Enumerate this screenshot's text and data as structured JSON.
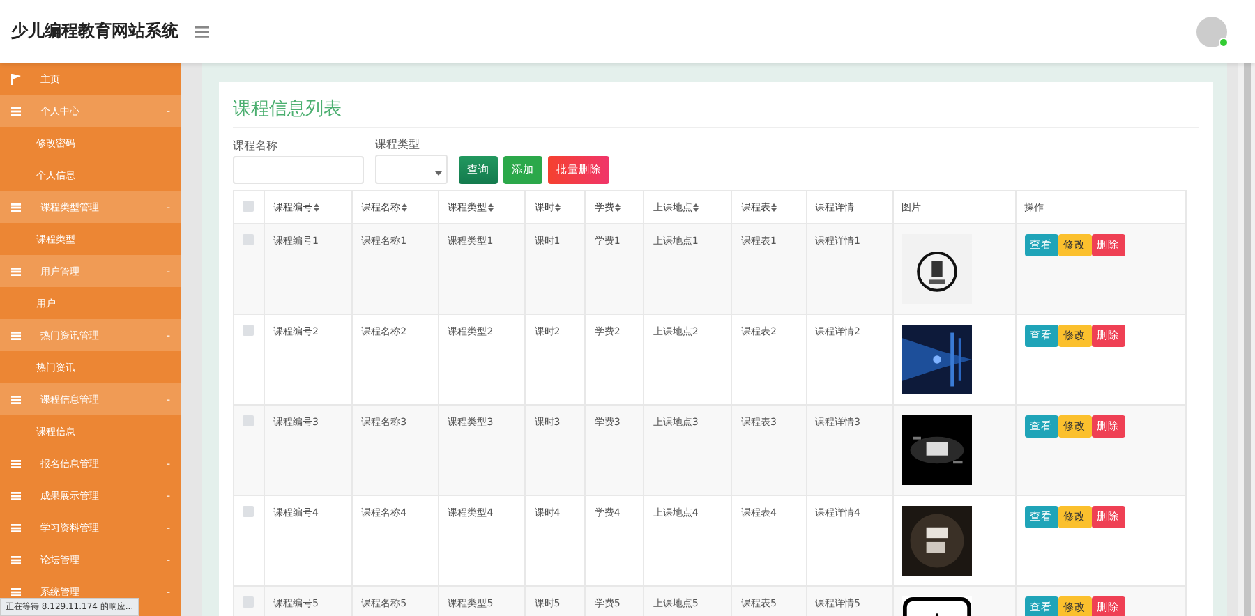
{
  "header": {
    "title": "少儿编程教育网站系统"
  },
  "sidebar": {
    "items": [
      {
        "label": "主页",
        "kind": "home",
        "expanded": false
      },
      {
        "label": "个人中心",
        "kind": "group",
        "expanded": true,
        "children": [
          {
            "label": "修改密码"
          },
          {
            "label": "个人信息"
          }
        ]
      },
      {
        "label": "课程类型管理",
        "kind": "group",
        "expanded": true,
        "children": [
          {
            "label": "课程类型"
          }
        ]
      },
      {
        "label": "用户管理",
        "kind": "group",
        "expanded": true,
        "children": [
          {
            "label": "用户"
          }
        ]
      },
      {
        "label": "热门资讯管理",
        "kind": "group",
        "expanded": true,
        "children": [
          {
            "label": "热门资讯"
          }
        ]
      },
      {
        "label": "课程信息管理",
        "kind": "group",
        "expanded": true,
        "children": [
          {
            "label": "课程信息"
          }
        ]
      },
      {
        "label": "报名信息管理",
        "kind": "group",
        "expanded": false
      },
      {
        "label": "成果展示管理",
        "kind": "group",
        "expanded": false
      },
      {
        "label": "学习资料管理",
        "kind": "group",
        "expanded": false
      },
      {
        "label": "论坛管理",
        "kind": "group",
        "expanded": false
      },
      {
        "label": "系统管理",
        "kind": "group",
        "expanded": false
      }
    ],
    "toggle": "-"
  },
  "page_title": "课程信息列表",
  "search": {
    "fields": [
      {
        "label": "课程名称",
        "kind": "text"
      },
      {
        "label": "课程类型",
        "kind": "select"
      }
    ],
    "buttons": [
      {
        "label": "查询",
        "kind": "query"
      },
      {
        "label": "添加",
        "kind": "add"
      },
      {
        "label": "批量删除",
        "kind": "delete"
      }
    ]
  },
  "table": {
    "select_all": {
      "checked": false
    },
    "columns": [
      {
        "label": "课程编号",
        "sortable": true
      },
      {
        "label": "课程名称",
        "sortable": true
      },
      {
        "label": "课程类型",
        "sortable": true
      },
      {
        "label": "课时",
        "sortable": true
      },
      {
        "label": "学费",
        "sortable": true
      },
      {
        "label": "上课地点",
        "sortable": true
      },
      {
        "label": "课程表",
        "sortable": true
      },
      {
        "label": "课程详情",
        "sortable": false
      },
      {
        "label": "图片",
        "sortable": false
      },
      {
        "label": "操作",
        "sortable": false
      }
    ],
    "rows": [
      {
        "checked": false,
        "cells": [
          "课程编号1",
          "课程名称1",
          "课程类型1",
          "课时1",
          "学费1",
          "上课地点1",
          "课程表1",
          "课程详情1"
        ],
        "actions": [
          {
            "label": "查看",
            "kind": "view"
          },
          {
            "label": "修改",
            "kind": "edit"
          },
          {
            "label": "删除",
            "kind": "delete"
          }
        ]
      },
      {
        "checked": false,
        "cells": [
          "课程编号2",
          "课程名称2",
          "课程类型2",
          "课时2",
          "学费2",
          "上课地点2",
          "课程表2",
          "课程详情2"
        ],
        "actions": [
          {
            "label": "查看",
            "kind": "view"
          },
          {
            "label": "修改",
            "kind": "edit"
          },
          {
            "label": "删除",
            "kind": "delete"
          }
        ]
      },
      {
        "checked": false,
        "cells": [
          "课程编号3",
          "课程名称3",
          "课程类型3",
          "课时3",
          "学费3",
          "上课地点3",
          "课程表3",
          "课程详情3"
        ],
        "actions": [
          {
            "label": "查看",
            "kind": "view"
          },
          {
            "label": "修改",
            "kind": "edit"
          },
          {
            "label": "删除",
            "kind": "delete"
          }
        ]
      },
      {
        "checked": false,
        "cells": [
          "课程编号4",
          "课程名称4",
          "课程类型4",
          "课时4",
          "学费4",
          "上课地点4",
          "课程表4",
          "课程详情4"
        ],
        "actions": [
          {
            "label": "查看",
            "kind": "view"
          },
          {
            "label": "修改",
            "kind": "edit"
          },
          {
            "label": "删除",
            "kind": "delete"
          }
        ]
      },
      {
        "checked": false,
        "cells": [
          "课程编号5",
          "课程名称5",
          "课程类型5",
          "课时5",
          "学费5",
          "上课地点5",
          "课程表5",
          "课程详情5"
        ],
        "actions": [
          {
            "label": "查看",
            "kind": "view"
          },
          {
            "label": "修改",
            "kind": "edit"
          },
          {
            "label": "删除",
            "kind": "delete"
          }
        ]
      }
    ]
  },
  "status_bar": "正在等待 8.129.11.174 的响应..."
}
